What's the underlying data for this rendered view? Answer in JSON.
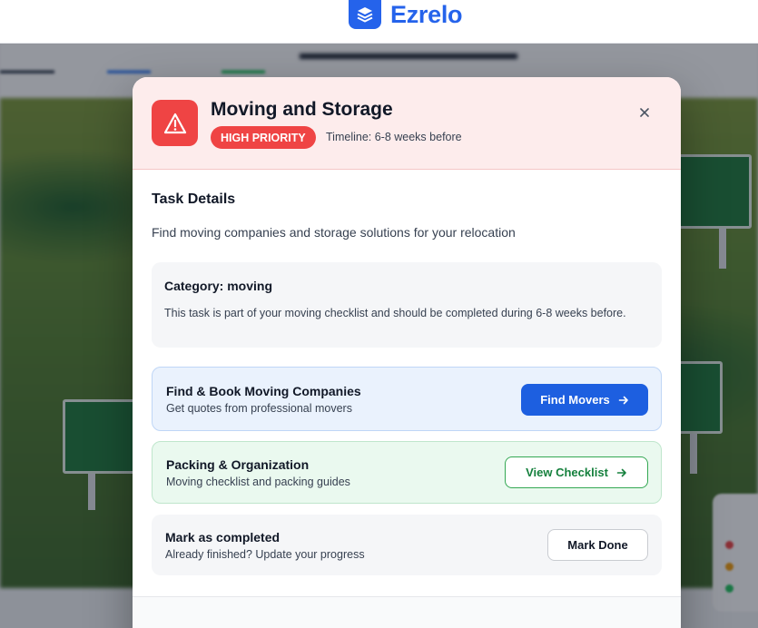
{
  "brand": {
    "name": "Ezrelo",
    "logo_icon": "layers-icon",
    "color": "#2563eb"
  },
  "modal": {
    "title": "Moving and Storage",
    "priority": "HIGH PRIORITY",
    "timeline": "Timeline: 6-8 weeks before",
    "header_icon": "warning-triangle-icon",
    "colors": {
      "priority": "#ef4444",
      "header_bg": "#fdecec"
    },
    "details_title": "Task Details",
    "description": "Find moving companies and storage solutions for your relocation",
    "category": {
      "title": "Category: moving",
      "text": "This task is part of your moving checklist and should be completed during 6-8 weeks before."
    },
    "actions": [
      {
        "title": "Find & Book Moving Companies",
        "subtitle": "Get quotes from professional movers",
        "button": "Find Movers",
        "accent": "#1d5fe0"
      },
      {
        "title": "Packing & Organization",
        "subtitle": "Moving checklist and packing guides",
        "button": "View Checklist",
        "accent": "#15803d"
      },
      {
        "title": "Mark as completed",
        "subtitle": "Already finished? Update your progress",
        "button": "Mark Done"
      }
    ]
  }
}
